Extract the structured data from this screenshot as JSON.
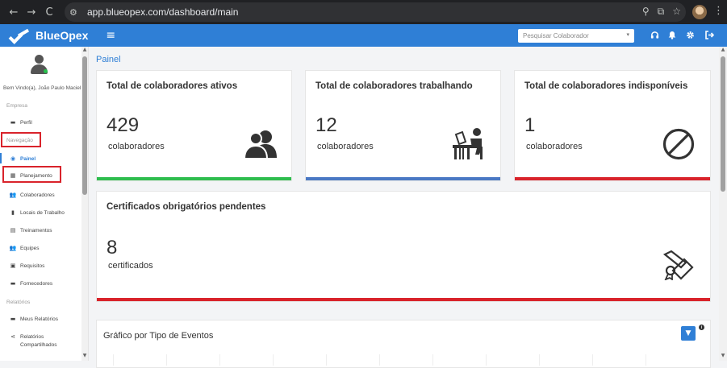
{
  "browser": {
    "back_icon": "←",
    "forward_icon": "→",
    "reload_icon": "C",
    "url": "app.blueopex.com/dashboard/main"
  },
  "header": {
    "brand": "BlueOpex",
    "menu_icon": "≡",
    "search_placeholder": "Pesquisar Colaborador",
    "caret": "▾",
    "icons": [
      "headset-icon",
      "bell-icon",
      "gear-icon",
      "logout-icon"
    ]
  },
  "sidebar": {
    "welcome": "Bem Vindo(a), João Paulo Maciel",
    "sections": {
      "empresa": "Empresa",
      "navegacao": "Navegação",
      "relatorios": "Relatórios"
    },
    "items": [
      {
        "label": "Perfil",
        "icon": "▬"
      },
      {
        "label": "Painel",
        "icon": "◉"
      },
      {
        "label": "Planejamento",
        "icon": "▦"
      },
      {
        "label": "Colaboradores",
        "icon": "👥"
      },
      {
        "label": "Locais de Trabalho",
        "icon": "▮"
      },
      {
        "label": "Treinamentos",
        "icon": "▤"
      },
      {
        "label": "Equipes",
        "icon": "👥"
      },
      {
        "label": "Requisitos",
        "icon": "▣"
      },
      {
        "label": "Fornecedores",
        "icon": "▬"
      },
      {
        "label": "Meus Relatórios",
        "icon": "▬"
      },
      {
        "label": "Relatórios",
        "label2": "Compartilhados",
        "icon": "⋖"
      }
    ]
  },
  "main": {
    "page_title": "Painel",
    "cards": [
      {
        "title": "Total de colaboradores ativos",
        "value": "429",
        "unit": "colaboradores",
        "color": "#2ebd4e",
        "icon": "users-icon"
      },
      {
        "title": "Total de colaboradores trabalhando",
        "value": "12",
        "unit": "colaboradores",
        "color": "#4a78c4",
        "icon": "worker-at-desk-icon"
      },
      {
        "title": "Total de colaboradores indisponíveis",
        "value": "1",
        "unit": "colaboradores",
        "color": "#d9232b",
        "icon": "ban-icon"
      },
      {
        "title": "Certificados obrigatórios pendentes",
        "value": "8",
        "unit": "certificados",
        "color": "#d9232b",
        "icon": "certificate-icon"
      }
    ],
    "chart": {
      "title": "Gráfico por Tipo de Eventos",
      "filter_icon": "▼",
      "info": "i"
    }
  }
}
